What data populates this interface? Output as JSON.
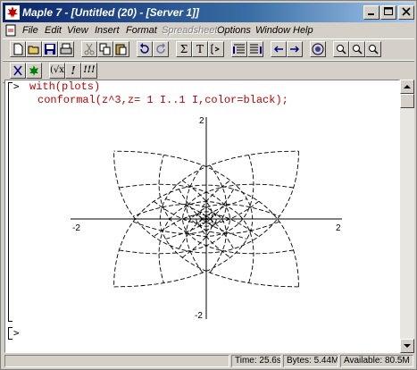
{
  "window": {
    "title": "Maple 7 - [Untitled (20) - [Server 1]]",
    "controls": [
      "minimize",
      "maximize",
      "close"
    ]
  },
  "menu": [
    "File",
    "Edit",
    "View",
    "Insert",
    "Format",
    "Spreadsheet",
    "Options",
    "Window",
    "Help"
  ],
  "menu_disabled": [
    "Spreadsheet"
  ],
  "toolbar_main": [
    "new-icon",
    "open-icon",
    "save-icon",
    "print-icon",
    "cut-icon",
    "copy-icon",
    "paste-icon",
    "undo-icon",
    "redo-icon",
    "sigma-icon",
    "text-icon",
    "prompt-icon",
    "collapse-icon",
    "expand-icon",
    "back-icon",
    "forward-icon",
    "stop-icon",
    "zoom-in-icon",
    "zoom-out-icon"
  ],
  "toolbar_context": [
    "mode-icon",
    "execute-icon",
    "sqrt-label",
    "exclaim-label",
    "execute-all-label"
  ],
  "context_labels": {
    "sqrt": "(√x)",
    "exclaim": "!",
    "all": "!!!"
  },
  "worksheet": {
    "prompt": ">",
    "input_lines": [
      "with(plots)",
      "conformal(z^3,z= 1 I..1 I,color=black);"
    ],
    "plot_ticks": {
      "x_neg": "-2",
      "x_pos": "2",
      "y_pos": "2",
      "y_neg": "-2"
    },
    "empty_prompt": ">"
  },
  "status": {
    "time": "Time: 25.6s",
    "bytes": "Bytes: 5.44M",
    "available": "Available: 80.5M"
  }
}
